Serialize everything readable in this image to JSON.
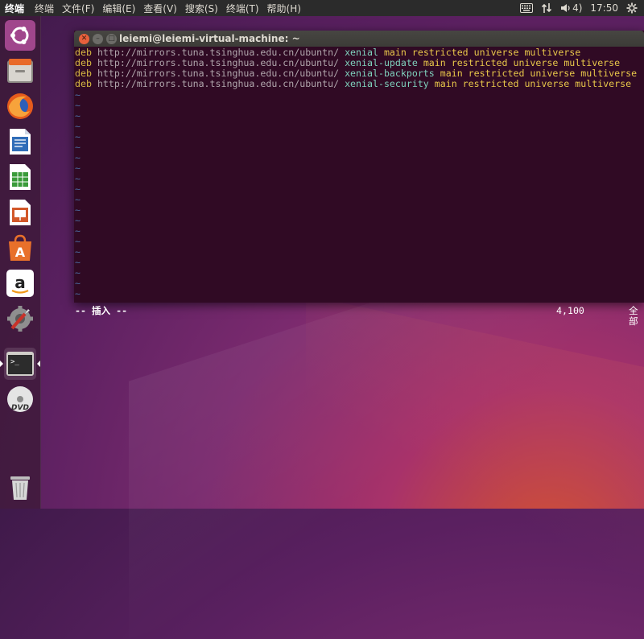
{
  "topbar": {
    "app_title": "终端",
    "menus": [
      "终端",
      "文件(F)",
      "编辑(E)",
      "查看(V)",
      "搜索(S)",
      "终端(T)",
      "帮助(H)"
    ],
    "volume": "4)",
    "time": "17:50"
  },
  "launcher": {
    "items": [
      "ubuntu-dash-icon",
      "files-icon",
      "firefox-icon",
      "writer-icon",
      "calc-icon",
      "impress-icon",
      "software-center-icon",
      "amazon-icon",
      "system-settings-icon",
      "terminal-icon",
      "dvd-icon",
      "trash-icon"
    ]
  },
  "terminal": {
    "title": "leiemi@leiemi-virtual-machine: ~",
    "lines": [
      {
        "deb": "deb",
        "url": "http://mirrors.tuna.tsinghua.edu.cn/ubuntn/",
        "dist": "xenial",
        "comps": "main restricted universe multiverse"
      },
      {
        "deb": "deb",
        "url": "http://mirrors.tuna.tsinghua.edu.cn/ubuntu/",
        "dist": "xenial-update",
        "comps": "main restricted universe multiverse"
      },
      {
        "deb": "deb",
        "url": "http://mirrors.tuna.tsinghua.edu.cn/ubuntu/",
        "dist": "xenial-backports",
        "comps": "main restricted universe multiverse"
      },
      {
        "deb": "deb",
        "url": "http://mirrors.tuna.tsinghua.edu.cn/ubuntu/",
        "dist": "xenial-security",
        "comps": "main restricted universe multiverse"
      }
    ],
    "tilde": "~",
    "mode": "-- 插入 --",
    "position": "4,100",
    "scroll": "全部"
  }
}
